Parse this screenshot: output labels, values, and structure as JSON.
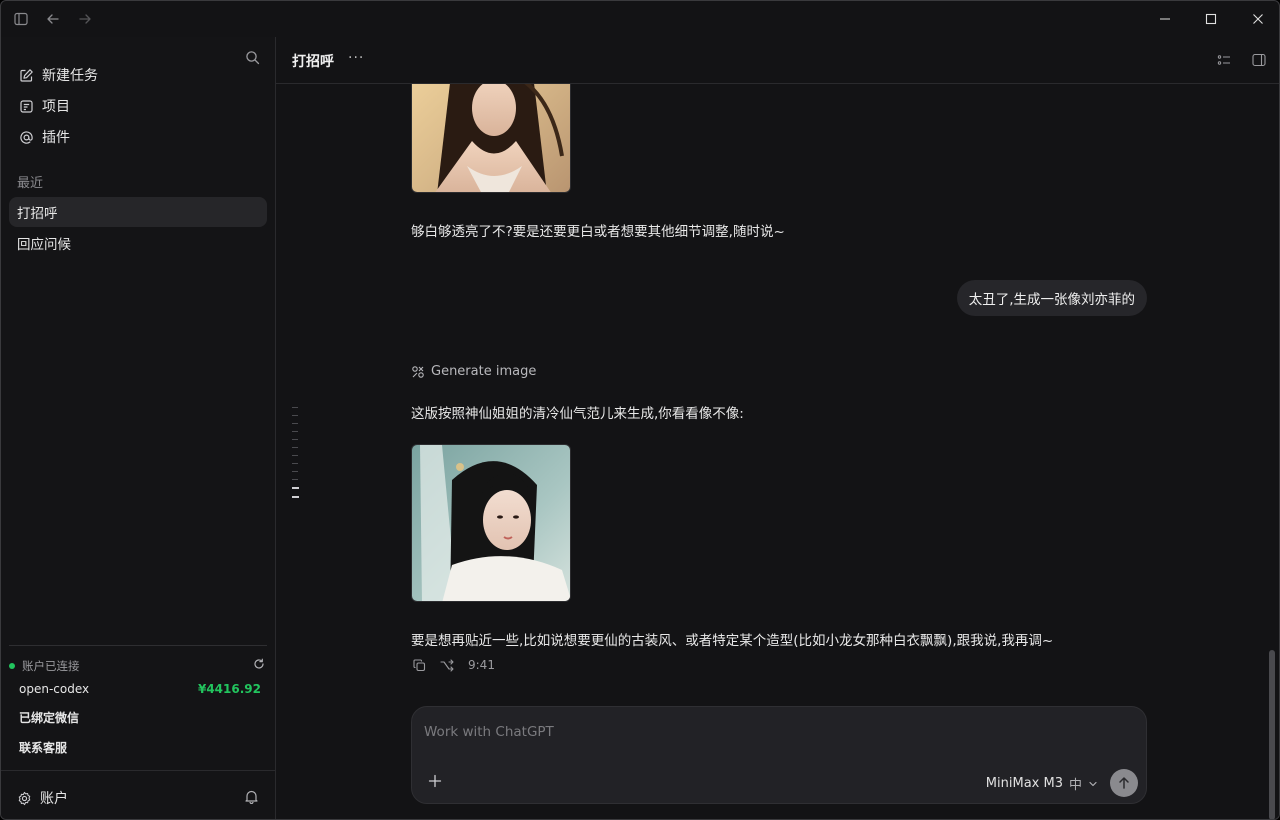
{
  "sidebar": {
    "nav": [
      {
        "label": "新建任务",
        "icon": "edit-icon"
      },
      {
        "label": "项目",
        "icon": "project-icon"
      },
      {
        "label": "插件",
        "icon": "at-icon"
      }
    ],
    "recent_label": "最近",
    "recent": [
      {
        "label": "打招呼",
        "active": true
      },
      {
        "label": "回应问候",
        "active": false
      }
    ],
    "account": {
      "status": "账户已连接",
      "name": "open-codex",
      "balance": "¥4416.92",
      "wechat": "已绑定微信",
      "support": "联系客服",
      "account_label": "账户"
    }
  },
  "main": {
    "title": "打招呼",
    "more": "···",
    "messages": {
      "assistant_1": "够白够透亮了不?要是还要更白或者想要其他细节调整,随时说~",
      "user_1": "太丑了,生成一张像刘亦菲的",
      "tool": "Generate image",
      "assistant_2_intro": "这版按照神仙姐姐的清冷仙气范儿来生成,你看看像不像:",
      "assistant_2_outro": "要是想再贴近一些,比如说想要更仙的古装风、或者特定某个造型(比如小龙女那种白衣飘飘),跟我说,我再调~",
      "time": "9:41"
    },
    "composer": {
      "placeholder": "Work with ChatGPT",
      "model": "MiniMax M3",
      "lang": "中"
    }
  },
  "colors": {
    "accent_green": "#22c55e",
    "background": "#131315",
    "bubble": "#26262a"
  }
}
